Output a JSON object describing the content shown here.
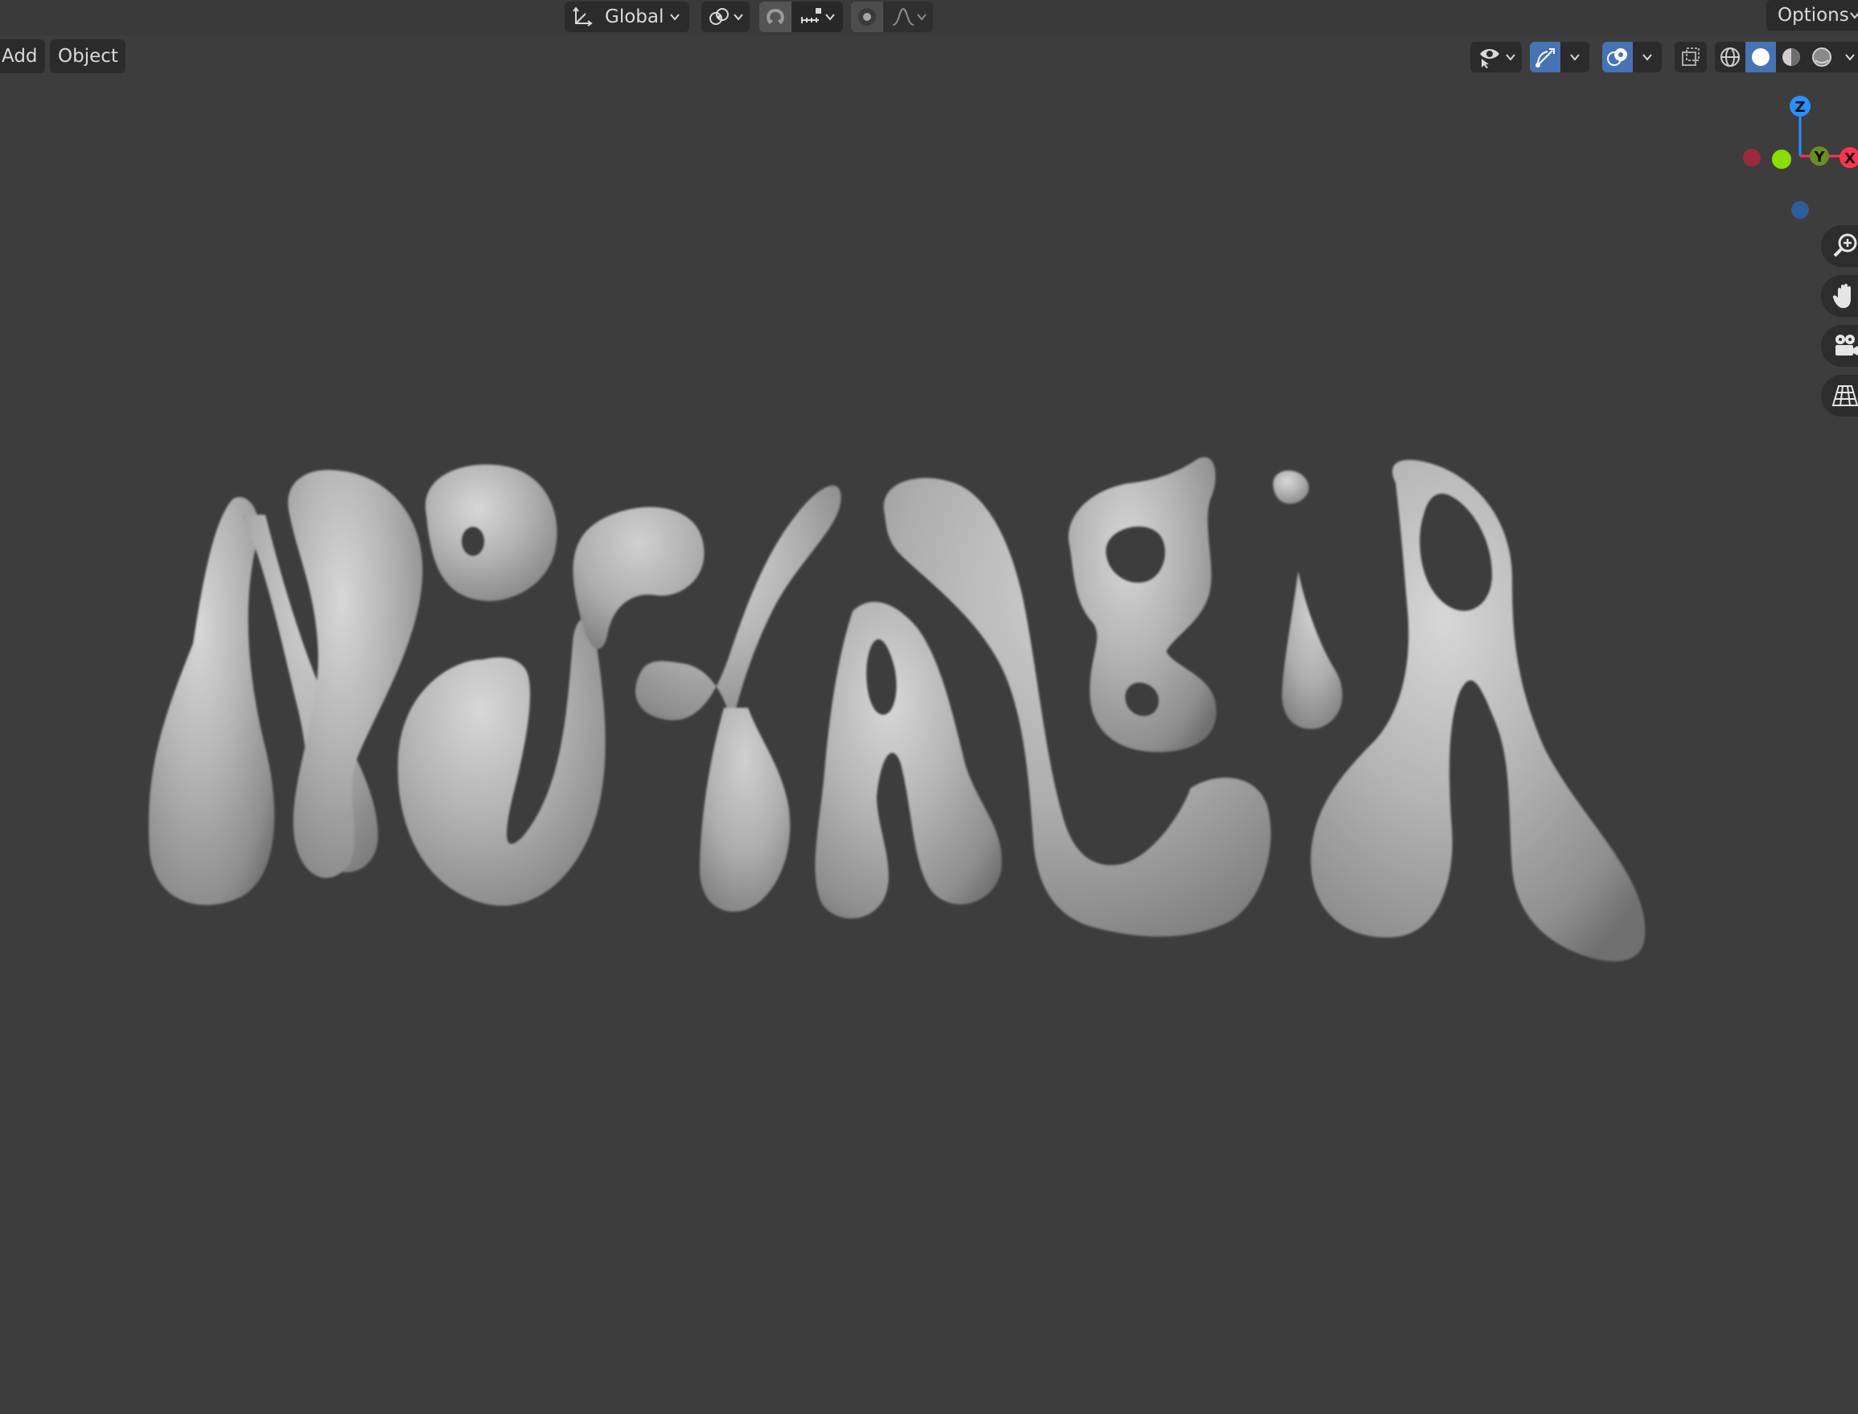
{
  "header": {
    "orientation": {
      "label": "Global",
      "icon": "transform-orientation-icon"
    },
    "pivot": {
      "icon": "pivot-point-icon"
    },
    "snap": {
      "toggle_icon": "magnet-icon",
      "target_icon": "snap-increment-icon"
    },
    "proportional": {
      "toggle_icon": "proportional-edit-icon",
      "falloff_icon": "falloff-curve-icon"
    },
    "options_label": "Options"
  },
  "viewport_header": {
    "menus": [
      {
        "label": "Add"
      },
      {
        "label": "Object"
      }
    ],
    "select_icon": "eye-selectability-icon",
    "gizmo_icon": "gizmo-icon",
    "overlay_icon": "overlays-icon",
    "xray_icon": "xray-icon",
    "shading_modes": [
      "wireframe",
      "solid",
      "material-preview",
      "rendered"
    ],
    "active_shading": "solid"
  },
  "navigation_gizmo": {
    "axes": {
      "z": "Z",
      "y": "Y",
      "x": "X"
    },
    "colors": {
      "x": "#ff3352",
      "y": "#8bdc00",
      "z": "#2890ff",
      "neg_x": "#9c2a3d",
      "neg_z": "#2e5d9e",
      "y_dim": "#6a8f20"
    }
  },
  "navigation_buttons": [
    "zoom-icon",
    "hand-pan-icon",
    "camera-icon",
    "perspective-grid-icon"
  ],
  "colors": {
    "viewport_bg": "#3d3d3d",
    "accent": "#4772b3",
    "mesh": "#b8b9b8"
  }
}
